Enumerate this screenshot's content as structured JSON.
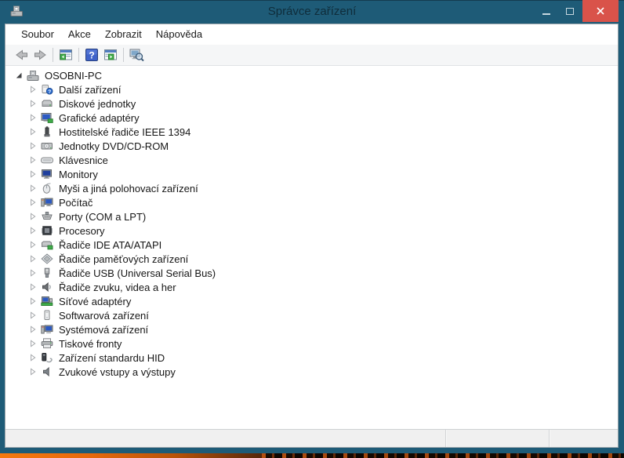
{
  "window": {
    "title": "Správce zařízení",
    "controls": {
      "minimize": "minimize",
      "maximize": "maximize",
      "close": "close"
    }
  },
  "menu_bar": {
    "items": [
      {
        "label": "Soubor"
      },
      {
        "label": "Akce"
      },
      {
        "label": "Zobrazit"
      },
      {
        "label": "Nápověda"
      }
    ]
  },
  "toolbar": {
    "buttons": [
      {
        "name": "back",
        "icon": "arrow-left-icon"
      },
      {
        "name": "forward",
        "icon": "arrow-right-icon"
      },
      {
        "name": "show-console-tree",
        "icon": "window-panel-left-icon"
      },
      {
        "name": "help",
        "icon": "help-icon"
      },
      {
        "name": "show-action-pane",
        "icon": "window-panel-right-icon"
      },
      {
        "name": "scan-hardware-changes",
        "icon": "scan-computer-icon"
      }
    ]
  },
  "tree": {
    "root": {
      "label": "OSOBNI-PC",
      "icon": "computer-root-icon",
      "expanded": true
    },
    "items": [
      {
        "label": "Další zařízení",
        "icon": "unknown-device-icon"
      },
      {
        "label": "Diskové jednotky",
        "icon": "disk-drive-icon"
      },
      {
        "label": "Grafické adaptéry",
        "icon": "display-adapter-icon"
      },
      {
        "label": "Hostitelské řadiče IEEE 1394",
        "icon": "ieee1394-icon"
      },
      {
        "label": "Jednotky DVD/CD-ROM",
        "icon": "dvd-drive-icon"
      },
      {
        "label": "Klávesnice",
        "icon": "keyboard-icon"
      },
      {
        "label": "Monitory",
        "icon": "monitor-icon"
      },
      {
        "label": "Myši a jiná polohovací zařízení",
        "icon": "mouse-icon"
      },
      {
        "label": "Počítač",
        "icon": "computer-icon"
      },
      {
        "label": "Porty (COM a LPT)",
        "icon": "ports-icon"
      },
      {
        "label": "Procesory",
        "icon": "processor-icon"
      },
      {
        "label": "Řadiče IDE ATA/ATAPI",
        "icon": "ide-controller-icon"
      },
      {
        "label": "Řadiče paměťových zařízení",
        "icon": "storage-controller-icon"
      },
      {
        "label": "Řadiče USB (Universal Serial Bus)",
        "icon": "usb-icon"
      },
      {
        "label": "Řadiče zvuku, videa a her",
        "icon": "sound-icon"
      },
      {
        "label": "Síťové adaptéry",
        "icon": "network-icon"
      },
      {
        "label": "Softwarová zařízení",
        "icon": "software-device-icon"
      },
      {
        "label": "Systémová zařízení",
        "icon": "system-device-icon"
      },
      {
        "label": "Tiskové fronty",
        "icon": "print-queue-icon"
      },
      {
        "label": "Zařízení standardu HID",
        "icon": "hid-icon"
      },
      {
        "label": "Zvukové vstupy a výstupy",
        "icon": "audio-io-icon"
      }
    ]
  },
  "status_bar": {
    "sections": [
      "",
      "",
      ""
    ]
  },
  "colors": {
    "titlebar_teal": "#1e5b77",
    "close_button_red": "#d9534a",
    "menu_bg": "#ffffff",
    "toolbar_bg": "#f5f6f7",
    "status_bg": "#f0f0f0",
    "desktop_orange": "#e8690d"
  }
}
